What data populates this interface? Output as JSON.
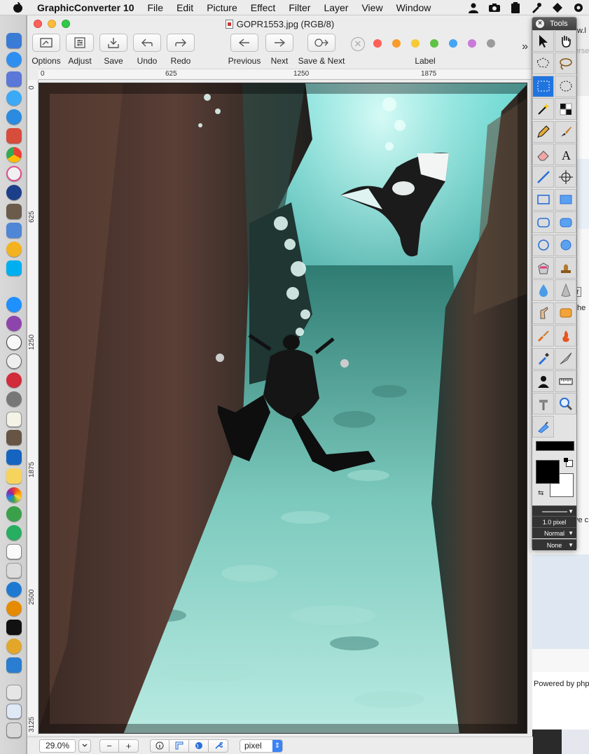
{
  "menubar": {
    "app_name": "GraphicConverter 10",
    "items": [
      "File",
      "Edit",
      "Picture",
      "Effect",
      "Filter",
      "Layer",
      "View",
      "Window"
    ]
  },
  "window": {
    "title": "GOPR1553.jpg (RGB/8)"
  },
  "toolbar": {
    "options": "Options",
    "adjust": "Adjust",
    "save": "Save",
    "undo": "Undo",
    "redo": "Redo",
    "previous": "Previous",
    "next": "Next",
    "save_next": "Save & Next",
    "label": "Label",
    "label_colors": [
      "#ff5f57",
      "#f99c2a",
      "#f6c935",
      "#5ec244",
      "#45a5f5",
      "#c97ad8",
      "#9b9b9b"
    ]
  },
  "rulers": {
    "horizontal": [
      "0",
      "625",
      "1250",
      "1875"
    ],
    "vertical": [
      "0",
      "625",
      "1250",
      "1875",
      "2500",
      "3125"
    ]
  },
  "statusbar": {
    "zoom": "29.0%",
    "minus": "−",
    "plus": "+",
    "unit": "pixel"
  },
  "tools_palette": {
    "title": "Tools",
    "line_width": "1.0 pixel",
    "blend_mode": "Normal",
    "extra": "None",
    "tools": [
      "arrow-tool",
      "hand-tool",
      "lasso-polygon-tool",
      "lasso-tool",
      "rect-select-tool",
      "ellipse-select-tool",
      "magic-wand-tool",
      "checkerboard-tool",
      "pencil-tool",
      "brush-tool",
      "eraser-tool",
      "text-tool",
      "line-tool",
      "crosshair-tool",
      "rect-tool",
      "filled-rect-tool",
      "rounded-rect-tool",
      "filled-rounded-rect-tool",
      "oval-tool",
      "filled-oval-tool",
      "paint-bucket-tool",
      "stamp-tool",
      "drop-tool",
      "cone-tool",
      "finger-tool",
      "sponge-tool",
      "red-brush-tool",
      "fire-brush-tool",
      "eyedropper-tool",
      "trowel-tool",
      "portrait-tool",
      "measure-tool",
      "hammer-tool",
      "zoom-tool",
      "tube-tool"
    ]
  },
  "background_window": {
    "texts": [
      "w.l",
      "erse",
      "r",
      "he",
      "ve c",
      "Powered by php"
    ]
  }
}
